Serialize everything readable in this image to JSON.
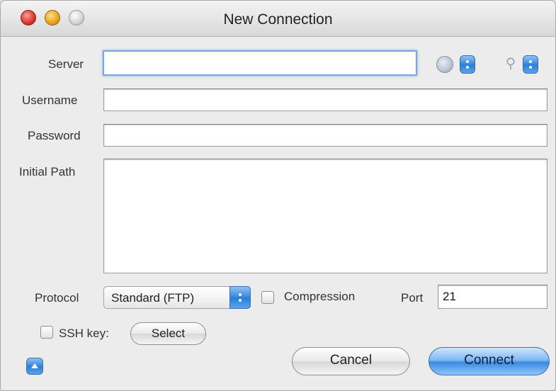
{
  "window": {
    "title": "New Connection"
  },
  "form": {
    "server_label": "Server",
    "server_value": "",
    "username_label": "Username",
    "username_value": "",
    "password_label": "Password",
    "password_value": "",
    "initial_path_label": "Initial Path",
    "initial_path_value": "",
    "protocol_label": "Protocol",
    "protocol_value": "Standard (FTP)",
    "compression_label": "Compression",
    "compression_checked": false,
    "port_label": "Port",
    "port_value": "21",
    "ssh_key_label": "SSH key:",
    "ssh_key_checked": false,
    "select_button": "Select"
  },
  "buttons": {
    "cancel": "Cancel",
    "connect": "Connect"
  },
  "colors": {
    "accent": "#3b8ae0",
    "focus_ring": "#7aa6e0"
  },
  "icons": {
    "bookmarks": "globe-icon",
    "keychain": "keychain-icon",
    "disclosure": "chevron-up-icon"
  }
}
